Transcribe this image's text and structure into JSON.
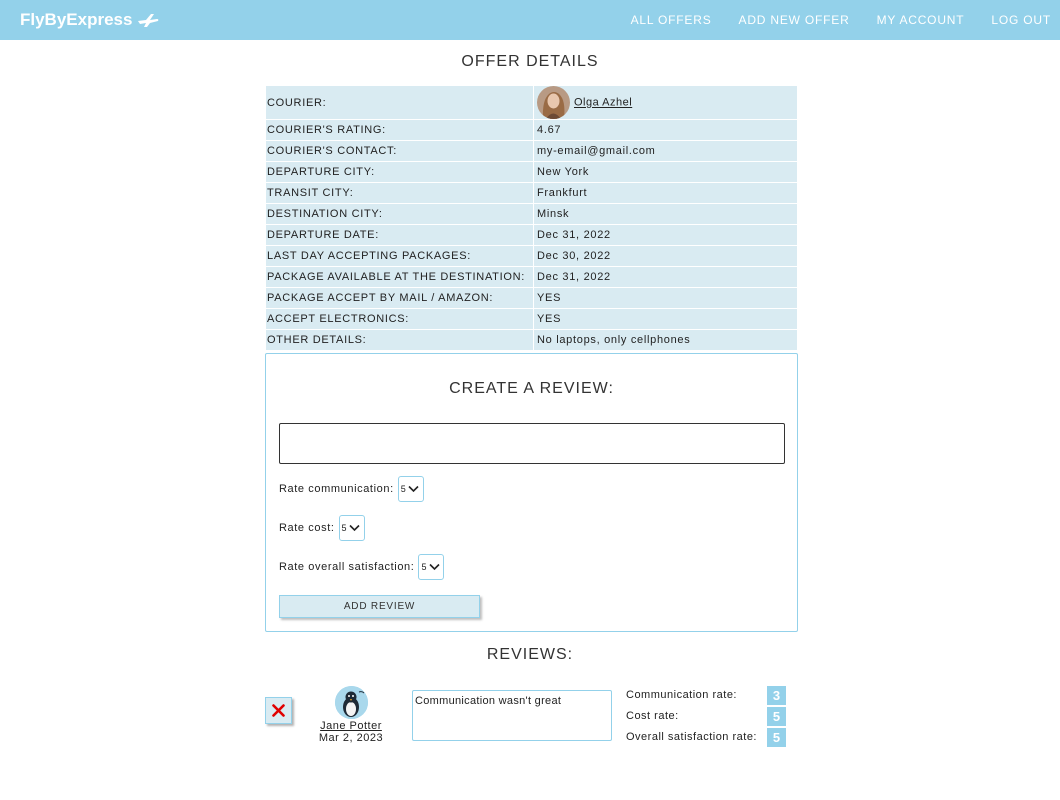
{
  "header": {
    "brand": "FlyByExpress",
    "nav": [
      "ALL OFFERS",
      "ADD NEW OFFER",
      "MY ACCOUNT",
      "LOG OUT"
    ]
  },
  "offer": {
    "title": "OFFER DETAILS",
    "rows": [
      {
        "label": "COURIER:",
        "value": "Olga Azhel"
      },
      {
        "label": "COURIER'S RATING:",
        "value": "4.67"
      },
      {
        "label": "COURIER'S CONTACT:",
        "value": "my-email@gmail.com"
      },
      {
        "label": "DEPARTURE CITY:",
        "value": "New York"
      },
      {
        "label": "TRANSIT CITY:",
        "value": "Frankfurt"
      },
      {
        "label": "DESTINATION CITY:",
        "value": "Minsk"
      },
      {
        "label": "DEPARTURE DATE:",
        "value": "Dec 31, 2022"
      },
      {
        "label": "LAST DAY ACCEPTING PACKAGES:",
        "value": "Dec 30, 2022"
      },
      {
        "label": "PACKAGE AVAILABLE AT THE DESTINATION:",
        "value": "Dec 31, 2022"
      },
      {
        "label": "PACKAGE ACCEPT BY MAIL / AMAZON:",
        "value": "YES"
      },
      {
        "label": "ACCEPT ELECTRONICS:",
        "value": "YES"
      },
      {
        "label": "OTHER DETAILS:",
        "value": "No laptops, only cellphones"
      }
    ]
  },
  "review_form": {
    "title": "CREATE A REVIEW:",
    "text_value": "",
    "rate_communication_label": "Rate communication:",
    "rate_communication_value": "5",
    "rate_cost_label": "Rate cost:",
    "rate_cost_value": "5",
    "rate_overall_label": "Rate overall satisfaction:",
    "rate_overall_value": "5",
    "submit_label": "ADD REVIEW"
  },
  "reviews": {
    "title": "REVIEWS:",
    "items": [
      {
        "author": "Jane Potter",
        "date": "Mar 2, 2023",
        "text": "Communication wasn't great",
        "communication_label": "Communication rate:",
        "communication_value": "3",
        "cost_label": "Cost rate:",
        "cost_value": "5",
        "overall_label": "Overall satisfaction rate:",
        "overall_value": "5"
      }
    ]
  },
  "colors": {
    "accent": "#93d1ea",
    "row_bg": "#d9ebf2",
    "delete_icon": "#e00000"
  },
  "icons": [
    "plane-icon",
    "courier-avatar",
    "chevron-down-icon",
    "close-icon",
    "penguin-avatar"
  ]
}
